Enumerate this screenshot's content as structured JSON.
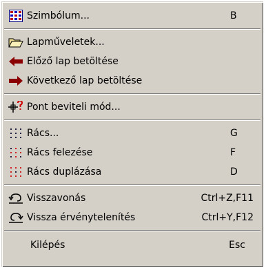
{
  "menu": {
    "items": [
      {
        "label": "Szimbólum...",
        "shortcut": "B",
        "icon": "symbol-grid-icon"
      },
      {
        "label": "Lapműveletek...",
        "shortcut": "",
        "icon": "open-folder-icon"
      },
      {
        "label": "Előző lap betöltése",
        "shortcut": "",
        "icon": "arrow-left-icon"
      },
      {
        "label": "Következő lap betöltése",
        "shortcut": "",
        "icon": "arrow-right-icon"
      },
      {
        "label": "Pont beviteli mód...",
        "shortcut": "",
        "icon": "point-input-mode-icon"
      },
      {
        "label": "Rács...",
        "shortcut": "G",
        "icon": "grid-dots-icon"
      },
      {
        "label": "Rács felezése",
        "shortcut": "F",
        "icon": "grid-half-icon"
      },
      {
        "label": "Rács duplázása",
        "shortcut": "D",
        "icon": "grid-double-icon"
      },
      {
        "label": "Visszavonás",
        "shortcut": "Ctrl+Z,F11",
        "icon": "undo-icon"
      },
      {
        "label": "Vissza érvénytelenítés",
        "shortcut": "Ctrl+Y,F12",
        "icon": "redo-icon"
      },
      {
        "label": "Kilépés",
        "shortcut": "Esc",
        "icon": ""
      }
    ]
  },
  "colors": {
    "menu_bg": "#d4d0c8",
    "arrow_red": "#8b0000",
    "grid_dot_red": "#d02020",
    "grid_dot_dark": "#202040"
  }
}
